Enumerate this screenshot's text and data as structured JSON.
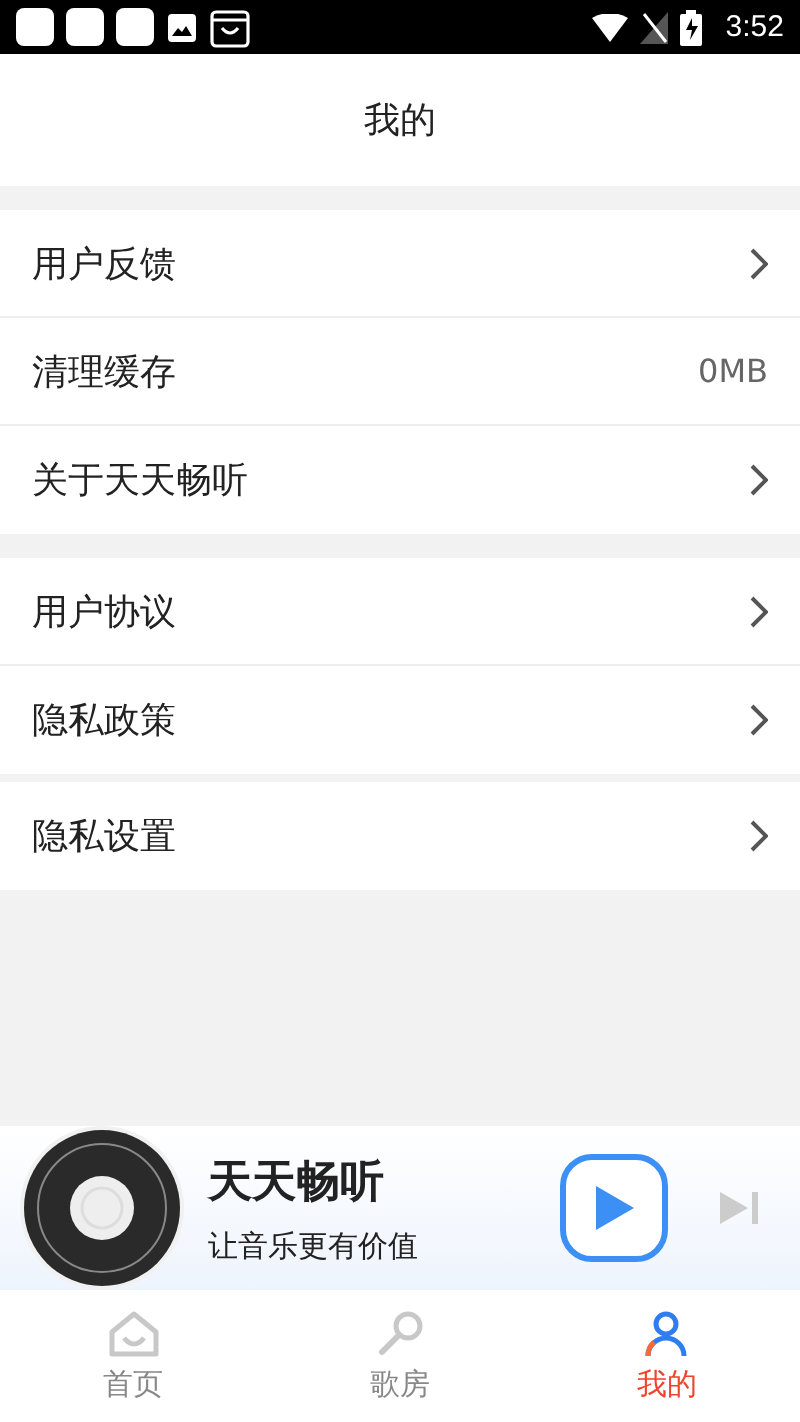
{
  "status_bar": {
    "time": "3:52"
  },
  "header": {
    "title": "我的"
  },
  "sections": [
    {
      "rows": [
        {
          "kind": "arrow",
          "label": "用户反馈"
        },
        {
          "kind": "value",
          "label": "清理缓存",
          "value": "0MB"
        },
        {
          "kind": "arrow",
          "label": "关于天天畅听"
        }
      ]
    },
    {
      "rows": [
        {
          "kind": "arrow",
          "label": "用户协议"
        },
        {
          "kind": "arrow",
          "label": "隐私政策"
        }
      ]
    },
    {
      "rows": [
        {
          "kind": "arrow",
          "label": "隐私设置"
        }
      ]
    }
  ],
  "player": {
    "title": "天天畅听",
    "subtitle": "让音乐更有价值"
  },
  "tab_bar": [
    {
      "kind": "home",
      "label": "首页",
      "selected": false
    },
    {
      "kind": "mic",
      "label": "歌房",
      "selected": false
    },
    {
      "kind": "person",
      "label": "我的",
      "selected": true
    }
  ]
}
